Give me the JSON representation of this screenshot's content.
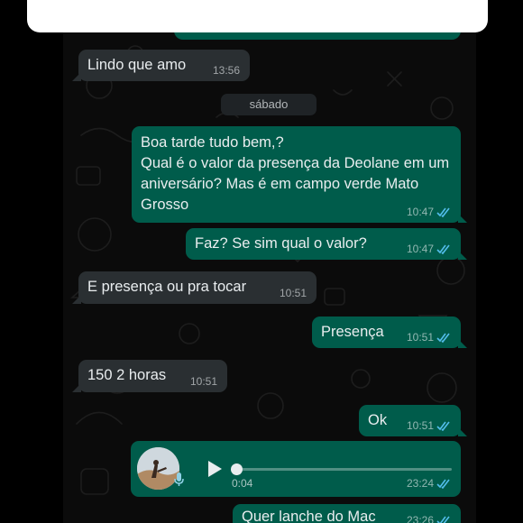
{
  "colors": {
    "incoming_bubble": "#2a2f32",
    "outgoing_bubble": "#005c4b",
    "read_ticks": "#53bdeb",
    "wallpaper": "#0b0b0b"
  },
  "day_separator": "sábado",
  "messages": [
    {
      "dir": "in",
      "text": "Lindo que amo",
      "time": "13:56"
    },
    {
      "dir": "out",
      "text": "Boa tarde tudo bem,?\nQual é o valor da presença da Deolane em um aniversário? Mas é em campo verde Mato Grosso",
      "time": "10:47",
      "status": "read"
    },
    {
      "dir": "out",
      "text": "Faz? Se sim qual o valor?",
      "time": "10:47",
      "status": "read"
    },
    {
      "dir": "in",
      "text": "E presença ou pra tocar",
      "time": "10:51"
    },
    {
      "dir": "out",
      "text": "Presença",
      "time": "10:51",
      "status": "read"
    },
    {
      "dir": "in",
      "text": "150 2 horas",
      "time": "10:51"
    },
    {
      "dir": "out",
      "text": "Ok",
      "time": "10:51",
      "status": "read"
    },
    {
      "dir": "out",
      "text": "Quer lanche do Mac",
      "time": "23:26",
      "status": "read"
    }
  ],
  "voice_message": {
    "duration": "0:04",
    "time": "23:24",
    "status": "read",
    "progress": 0.0
  }
}
